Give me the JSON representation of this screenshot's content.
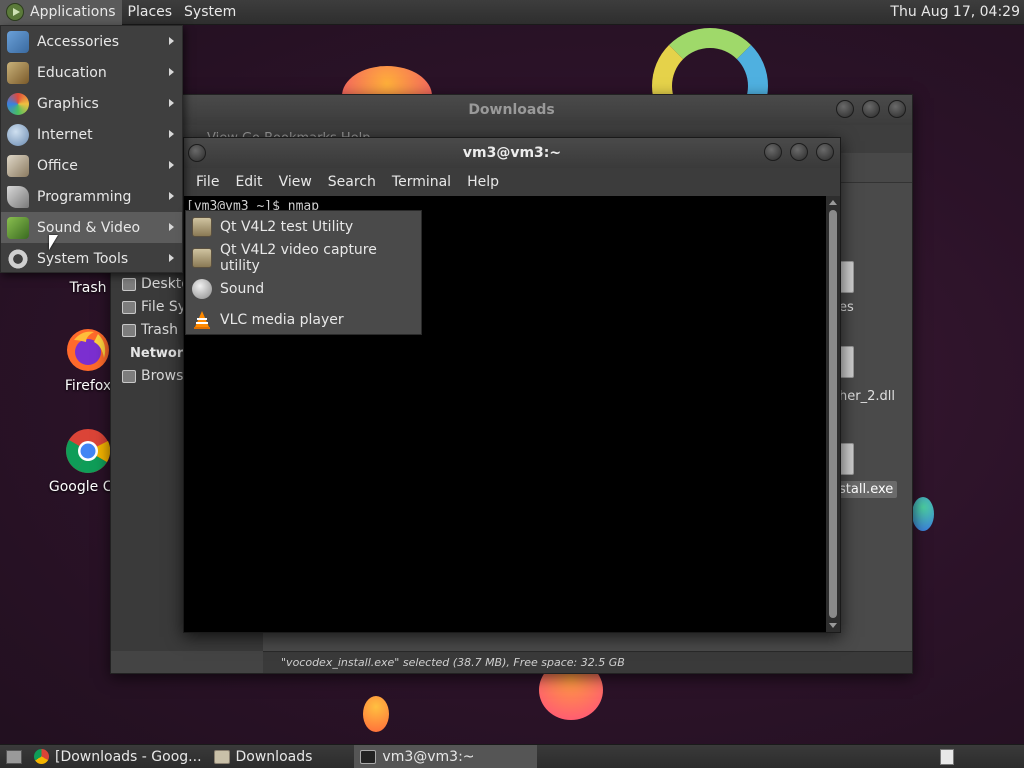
{
  "top_panel": {
    "applications": "Applications",
    "places": "Places",
    "system": "System",
    "clock": "Thu Aug 17, 04:29"
  },
  "apps_menu": {
    "items": [
      {
        "label": "Accessories",
        "icon": "accessories-icon"
      },
      {
        "label": "Education",
        "icon": "education-icon"
      },
      {
        "label": "Graphics",
        "icon": "graphics-icon"
      },
      {
        "label": "Internet",
        "icon": "internet-icon"
      },
      {
        "label": "Office",
        "icon": "office-icon"
      },
      {
        "label": "Programming",
        "icon": "programming-icon"
      },
      {
        "label": "Sound & Video",
        "icon": "sound-video-icon",
        "highlighted": true
      },
      {
        "label": "System Tools",
        "icon": "system-tools-icon"
      }
    ]
  },
  "sound_video_submenu": {
    "items": [
      {
        "label": "Qt V4L2 test Utility",
        "icon": "qt-v4l2-icon"
      },
      {
        "label": "Qt V4L2 video capture utility",
        "icon": "qt-v4l2-capture-icon"
      },
      {
        "label": "Sound",
        "icon": "sound-icon"
      },
      {
        "label": "VLC media player",
        "icon": "vlc-icon"
      }
    ]
  },
  "desktop_icons": {
    "trash": "Trash",
    "firefox": "Firefox",
    "chrome": "Google Chr"
  },
  "downloads_window": {
    "title": "Downloads",
    "menubar_text": "View  Go  Bookmarks  Help",
    "sidebar": {
      "items": [
        "Desktop",
        "File System",
        "Trash"
      ],
      "network_heading": "Network",
      "network_items": [
        "Browse Network"
      ]
    },
    "files": {
      "partial_1": "es",
      "partial_2": "her_2.dll",
      "selected": "stall.exe"
    },
    "status": "\"vocodex_install.exe\" selected (38.7 MB), Free space: 32.5 GB"
  },
  "terminal_window": {
    "title": "vm3@vm3:~",
    "menu": [
      "File",
      "Edit",
      "View",
      "Search",
      "Terminal",
      "Help"
    ],
    "content": "[vm3@vm3 ~]$ nmap"
  },
  "taskbar": {
    "tasks": [
      {
        "label": "[Downloads - Goog...",
        "icon": "chrome-icon"
      },
      {
        "label": "Downloads",
        "icon": "folder-icon"
      },
      {
        "label": "vm3@vm3:~",
        "icon": "terminal-icon",
        "active": true
      }
    ]
  },
  "colors": {
    "panel": "#333333",
    "menu_bg": "#3f3f3f",
    "menu_highlight": "#5c5c5c",
    "wallpaper": "#2b1228",
    "terminal_bg": "#000000"
  }
}
